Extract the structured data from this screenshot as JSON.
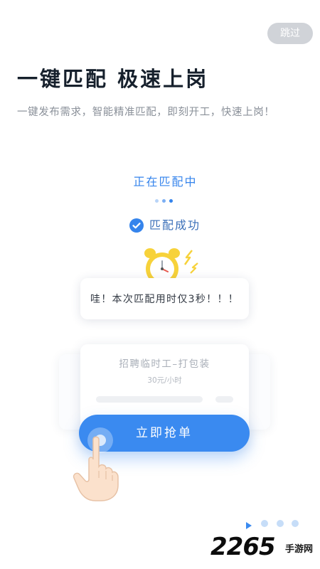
{
  "header": {
    "skip_label": "跳过",
    "title": "一键匹配  极速上岗",
    "subtitle": "一键发布需求，智能精准匹配，即刻开工，快速上岗！"
  },
  "matching": {
    "status_text": "正在匹配中",
    "success_text": "匹配成功",
    "toast_text": "哇！本次匹配用时仅3秒！！！"
  },
  "job_card": {
    "title": "招聘临时工–打包装",
    "pay": "30元/小时",
    "action_label": "立即抢单"
  },
  "pager": {
    "total": 4,
    "current": 1
  },
  "watermark": {
    "number": "2265",
    "suffix": "手游网"
  },
  "colors": {
    "accent": "#3a8af0",
    "clock": "#f7d23a",
    "skip_bg": "#d0d3d8"
  },
  "icons": [
    "check-circle-icon",
    "alarm-clock-icon",
    "pointing-hand-icon",
    "play-arrow-icon"
  ]
}
